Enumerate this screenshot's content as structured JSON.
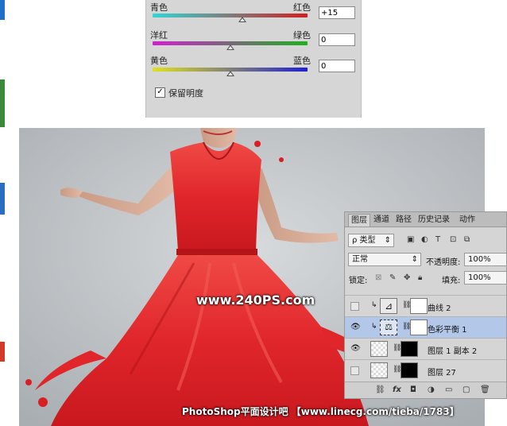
{
  "color_balance": {
    "sliders": [
      {
        "left_label": "青色",
        "right_label": "红色",
        "value": "+15",
        "position": 0.58,
        "gradient": [
          "#2fd6d6",
          "#d02020"
        ]
      },
      {
        "left_label": "洋红",
        "right_label": "绿色",
        "value": "0",
        "position": 0.5,
        "gradient": [
          "#d020d0",
          "#20b020"
        ]
      },
      {
        "left_label": "黄色",
        "right_label": "蓝色",
        "value": "0",
        "position": 0.5,
        "gradient": [
          "#e0e020",
          "#2020d0"
        ]
      }
    ],
    "preserve_luminosity_label": "保留明度",
    "preserve_luminosity_checked": true,
    "check_mark": "✓"
  },
  "layers_panel": {
    "tabs": [
      "图层",
      "通道",
      "路径",
      "历史记录",
      "动作"
    ],
    "active_tab": 0,
    "filter_label": "ρ 类型",
    "blend_mode": "正常",
    "opacity_label": "不透明度:",
    "opacity_value": "100%",
    "lock_label": "锁定:",
    "fill_label": "填充:",
    "fill_value": "100%",
    "layers": [
      {
        "name": "曲线 2",
        "visible": false,
        "type": "adjustment-curves",
        "selected": false
      },
      {
        "name": "色彩平衡 1",
        "visible": true,
        "type": "adjustment-color-balance",
        "selected": true
      },
      {
        "name": "图层 1 副本 2",
        "visible": true,
        "type": "pixel-masked",
        "selected": false
      },
      {
        "name": "图层 27",
        "visible": false,
        "type": "pixel-masked",
        "selected": false
      }
    ],
    "footer_icons": [
      "link-icon",
      "fx-icon",
      "mask-icon",
      "adjustment-icon",
      "folder-icon",
      "new-layer-icon",
      "trash-icon"
    ]
  },
  "watermarks": {
    "site": "www.240PS.com",
    "footer": "PhotoShop平面设计吧 【www.linecg.com/tieba/1783】"
  },
  "colors": {
    "panel_bg": "#d6d6d6",
    "selected_layer": "#b3c8e8",
    "dress_red": "#e0262b",
    "photo_bg": "#c6cacd"
  }
}
